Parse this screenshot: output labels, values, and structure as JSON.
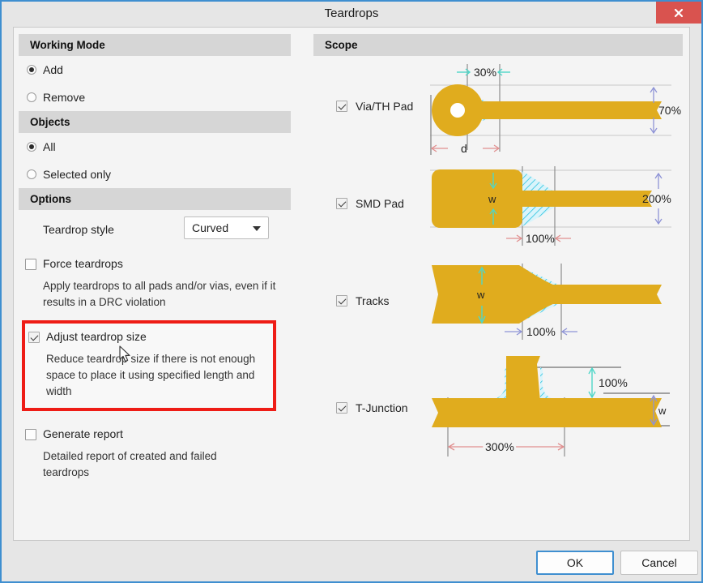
{
  "window": {
    "title": "Teardrops",
    "close_icon": "close-icon",
    "accent_border": "#3f8fd0",
    "close_bg": "#d9534f"
  },
  "left": {
    "working_mode": {
      "header": "Working Mode",
      "options": [
        {
          "label": "Add",
          "selected": true
        },
        {
          "label": "Remove",
          "selected": false
        }
      ]
    },
    "objects": {
      "header": "Objects",
      "options": [
        {
          "label": "All",
          "selected": true
        },
        {
          "label": "Selected only",
          "selected": false
        }
      ]
    },
    "options": {
      "header": "Options",
      "teardrop_style_label": "Teardrop style",
      "teardrop_style_value": "Curved",
      "force_teardrops": {
        "label": "Force teardrops",
        "checked": false,
        "description": "Apply teardrops to all pads and/or vias, even if it results in a DRC violation"
      },
      "adjust_size": {
        "label": "Adjust teardrop size",
        "checked": true,
        "description": "Reduce teardrop size if there is not enough space to place it using specified length and width",
        "highlighted": true,
        "highlight_color": "#ee1c16"
      },
      "generate_report": {
        "label": "Generate report",
        "checked": false,
        "description": "Detailed report of created and failed teardrops"
      }
    }
  },
  "scope": {
    "header": "Scope",
    "items": [
      {
        "label": "Via/TH Pad",
        "checked": true,
        "annotations": {
          "length_pct": "30%",
          "width_pct": "70%",
          "dim": "d"
        }
      },
      {
        "label": "SMD Pad",
        "checked": true,
        "annotations": {
          "width_label": "w",
          "width_pct": "200%",
          "length_pct": "100%"
        }
      },
      {
        "label": "Tracks",
        "checked": true,
        "annotations": {
          "width_label": "w",
          "length_pct": "100%"
        }
      },
      {
        "label": "T-Junction",
        "checked": true,
        "annotations": {
          "height_pct": "100%",
          "length_pct": "300%",
          "width_label": "w"
        }
      }
    ],
    "colors": {
      "copper": "#e0ac1e",
      "teardrop_hatch": "#2ec4e0",
      "teardrop_fill": "#d9f4fb",
      "teal_arrow": "#4fd6c8",
      "red_arrow": "#e08f8f",
      "blue_arrow": "#8e93d6",
      "guide_line": "#7a7a7a"
    }
  },
  "footer": {
    "ok_label": "OK",
    "cancel_label": "Cancel"
  }
}
